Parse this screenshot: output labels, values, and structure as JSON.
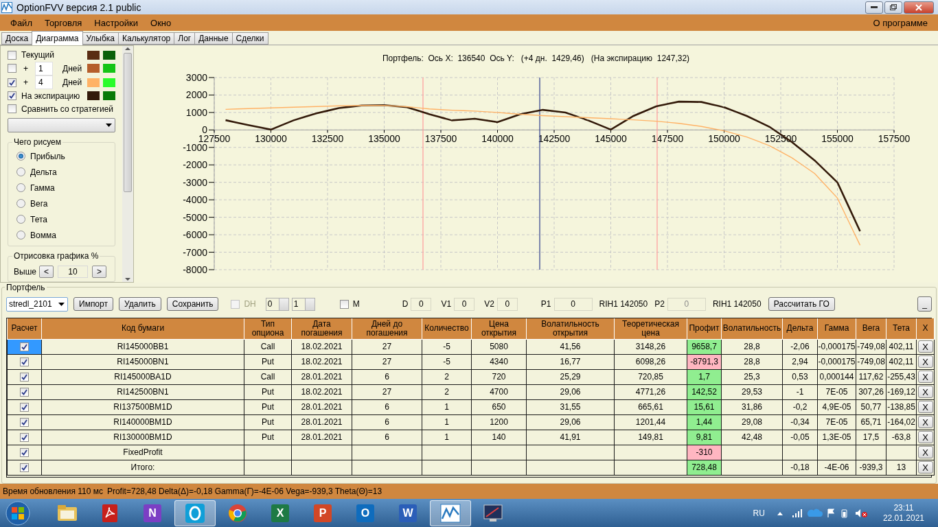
{
  "window": {
    "title": "OptionFVV версия 2.1 public"
  },
  "menu": [
    {
      "label": "Файл"
    },
    {
      "label": "Торговля"
    },
    {
      "label": "Настройки"
    },
    {
      "label": "Окно"
    }
  ],
  "menu_right": {
    "label": "О программе"
  },
  "tabs": [
    {
      "label": "Доска",
      "selected": false
    },
    {
      "label": "Диаграмма",
      "selected": true
    },
    {
      "label": "Улыбка",
      "selected": false
    },
    {
      "label": "Калькулятор",
      "selected": false
    },
    {
      "label": "Лог",
      "selected": false
    },
    {
      "label": "Данные",
      "selected": false
    },
    {
      "label": "Сделки",
      "selected": false
    }
  ],
  "left_panel": {
    "rows": [
      {
        "kind": "check",
        "label": "Текущий",
        "checked": false,
        "swatches": [
          {
            "color": "#5a2d14"
          },
          {
            "color": "#0a600a"
          }
        ]
      },
      {
        "kind": "days",
        "prefix": "+",
        "value": "1",
        "unit": "Дней",
        "checked": false,
        "swatches": [
          {
            "color": "#b55e2b"
          },
          {
            "color": "#15c415"
          }
        ]
      },
      {
        "kind": "days",
        "prefix": "+",
        "value": "4",
        "unit": "Дней",
        "checked": true,
        "swatches": [
          {
            "color": "#ffb266"
          },
          {
            "color": "#2afc2a"
          }
        ]
      },
      {
        "kind": "check",
        "label": "На экспирацию",
        "checked": true,
        "swatches": [
          {
            "color": "#331a0a"
          },
          {
            "color": "#087a08"
          }
        ]
      },
      {
        "kind": "check",
        "label": "Сравнить со стратегией",
        "checked": false
      }
    ],
    "draw_group": {
      "title": "Чего рисуем",
      "options": [
        {
          "label": "Прибыль",
          "selected": true
        },
        {
          "label": "Дельта",
          "selected": false
        },
        {
          "label": "Гамма",
          "selected": false
        },
        {
          "label": "Вега",
          "selected": false
        },
        {
          "label": "Тета",
          "selected": false
        },
        {
          "label": "Вомма",
          "selected": false
        }
      ]
    },
    "render_group": {
      "title": "Отрисовка графика %",
      "label": "Выше",
      "dec": "<",
      "value": "10",
      "inc": ">"
    }
  },
  "chart": {
    "title": "Портфель:  Ось X:  136540  Ось Y:   (+4 дн.  1429,46)   (На экспирацию  1247,32)",
    "chart_data": {
      "type": "line",
      "x": [
        128000,
        129000,
        130000,
        131000,
        132000,
        133000,
        134000,
        135000,
        136000,
        137000,
        138000,
        139000,
        140000,
        141000,
        142000,
        143000,
        144000,
        145000,
        146000,
        147000,
        148000,
        149000,
        150000,
        151000,
        152000,
        153000,
        154000,
        155000,
        156000
      ],
      "series": [
        {
          "color": "#331a0a",
          "values": [
            560,
            280,
            20,
            550,
            950,
            1250,
            1400,
            1420,
            1300,
            900,
            550,
            640,
            450,
            900,
            1150,
            1000,
            550,
            20,
            800,
            1350,
            1620,
            1600,
            1300,
            800,
            180,
            -700,
            -1750,
            -3000,
            -5800
          ]
        },
        {
          "color": "#ffb266",
          "values": [
            1180,
            1220,
            1260,
            1300,
            1340,
            1380,
            1400,
            1400,
            1330,
            1200,
            1130,
            1080,
            1000,
            900,
            820,
            760,
            700,
            640,
            580,
            500,
            380,
            200,
            -50,
            -400,
            -900,
            -1600,
            -2500,
            -3900,
            -6600
          ]
        }
      ],
      "xlim": [
        127500,
        157500
      ],
      "ylim": [
        -8000,
        3000
      ],
      "xticks": [
        127500,
        130000,
        132500,
        135000,
        137500,
        140000,
        142500,
        145000,
        147500,
        150000,
        152500,
        155000,
        157500
      ],
      "yticks": [
        -8000,
        -7000,
        -6000,
        -5000,
        -4000,
        -3000,
        -2000,
        -1000,
        0,
        1000,
        2000,
        3000
      ],
      "grid": true,
      "ref_lines": [
        {
          "axis": "x",
          "value": 136712,
          "color": "#ff9a9a"
        },
        {
          "axis": "x",
          "value": 141864,
          "color": "#2a3a8a"
        },
        {
          "axis": "x",
          "value": 147045,
          "color": "#ff9a9a"
        }
      ]
    }
  },
  "portfolio": {
    "title": "Портфель",
    "toolbar": {
      "portfolio": "stredl_2101",
      "buttons": [
        {
          "label": "Импорт"
        },
        {
          "label": "Удалить"
        },
        {
          "label": "Сохранить"
        }
      ],
      "dh": {
        "label": "DH",
        "checked": false,
        "disabled": true
      },
      "spinners": [
        {
          "value": "0"
        },
        {
          "value": "1"
        }
      ],
      "m": {
        "label": "M",
        "checked": false
      },
      "fields": [
        {
          "label": "D",
          "value": "0",
          "disabled": false
        },
        {
          "label": "V1",
          "value": "0",
          "disabled": false
        },
        {
          "label": "V2",
          "value": "0",
          "disabled": false
        },
        {
          "label": "P1",
          "value": "0",
          "disabled": false,
          "note": "RIH1 142050"
        },
        {
          "label": "P2",
          "value": "0",
          "disabled": true,
          "note": "RIH1 142050"
        }
      ],
      "calc_button": "Рассчитать ГО",
      "minimize_button": "_"
    },
    "table": {
      "columns": [
        "Расчет",
        "Код бумаги",
        "Тип\nопциона",
        "Дата\nпогашения",
        "Дней до\nпогашения",
        "Количество",
        "Цена\nоткрытия",
        "Волатильность\nоткрытия",
        "Теоретическая\nцена",
        "Профит",
        "Волатильность",
        "Дельта",
        "Гамма",
        "Вега",
        "Тета",
        "X"
      ],
      "rows": [
        {
          "checked": true,
          "selected": true,
          "color": "#90ee90",
          "cells": [
            "",
            "RI145000BB1",
            "Call",
            "18.02.2021",
            "27",
            "-5",
            "5080",
            "41,56",
            "3148,26",
            "9658,7",
            "28,8",
            "-2,06",
            "-0,000175",
            "-749,08",
            "402,11",
            "X"
          ]
        },
        {
          "checked": true,
          "selected": false,
          "color": "#ffb6c1",
          "cells": [
            "",
            "RI145000BN1",
            "Put",
            "18.02.2021",
            "27",
            "-5",
            "4340",
            "16,77",
            "6098,26",
            "-8791,3",
            "28,8",
            "2,94",
            "-0,000175",
            "-749,08",
            "402,11",
            "X"
          ]
        },
        {
          "checked": true,
          "selected": false,
          "color": "#90ee90",
          "cells": [
            "",
            "RI145000BA1D",
            "Call",
            "28.01.2021",
            "6",
            "2",
            "720",
            "25,29",
            "720,85",
            "1,7",
            "25,3",
            "0,53",
            "0,000144",
            "117,62",
            "-255,43",
            "X"
          ]
        },
        {
          "checked": true,
          "selected": false,
          "color": "#90ee90",
          "cells": [
            "",
            "RI142500BN1",
            "Put",
            "18.02.2021",
            "27",
            "2",
            "4700",
            "29,06",
            "4771,26",
            "142,52",
            "29,53",
            "-1",
            "7E-05",
            "307,26",
            "-169,12",
            "X"
          ]
        },
        {
          "checked": true,
          "selected": false,
          "color": "#90ee90",
          "cells": [
            "",
            "RI137500BM1D",
            "Put",
            "28.01.2021",
            "6",
            "1",
            "650",
            "31,55",
            "665,61",
            "15,61",
            "31,86",
            "-0,2",
            "4,9E-05",
            "50,77",
            "-138,85",
            "X"
          ]
        },
        {
          "checked": true,
          "selected": false,
          "color": "#90ee90",
          "cells": [
            "",
            "RI140000BM1D",
            "Put",
            "28.01.2021",
            "6",
            "1",
            "1200",
            "29,06",
            "1201,44",
            "1,44",
            "29,08",
            "-0,34",
            "7E-05",
            "65,71",
            "-164,02",
            "X"
          ]
        },
        {
          "checked": true,
          "selected": false,
          "color": "#90ee90",
          "cells": [
            "",
            "RI130000BM1D",
            "Put",
            "28.01.2021",
            "6",
            "1",
            "140",
            "41,91",
            "149,81",
            "9,81",
            "42,48",
            "-0,05",
            "1,3E-05",
            "17,5",
            "-63,8",
            "X"
          ]
        },
        {
          "checked": true,
          "selected": false,
          "color": "#ffb6c1",
          "cells": [
            "",
            "FixedProfit",
            "",
            "",
            "",
            "",
            "",
            "",
            "",
            "-310",
            "",
            "",
            "",
            "",
            "",
            "X"
          ]
        },
        {
          "checked": true,
          "selected": false,
          "color": "#90ee90",
          "cells": [
            "",
            "Итого:",
            "",
            "",
            "",
            "",
            "",
            "",
            "",
            "728,48",
            "",
            "-0,18",
            "-4E-06",
            "-939,3",
            "13",
            "X"
          ]
        }
      ]
    }
  },
  "status_bar": {
    "update": "Время обновления 110 мс",
    "summary": "Profit=728,48 Delta(Δ)=-0,18 Gamma(Г)=-4E-06 Vega=-939,3 Theta(Θ)=13"
  },
  "taskbar": {
    "apps": [
      {
        "kind": "folder",
        "selected": false
      },
      {
        "kind": "pdf",
        "selected": false
      },
      {
        "kind": "letter",
        "glyph": "N",
        "color": "#7b3fc4",
        "selected": false
      },
      {
        "kind": "ring",
        "selected": true
      },
      {
        "kind": "globe",
        "selected": false
      },
      {
        "kind": "letter",
        "glyph": "X",
        "color": "#1e7a45",
        "selected": false
      },
      {
        "kind": "letter",
        "glyph": "P",
        "color": "#d24726",
        "selected": false
      },
      {
        "kind": "letter",
        "glyph": "O",
        "color": "#0f6cbd",
        "selected": false
      },
      {
        "kind": "letter",
        "glyph": "W",
        "color": "#2b5eb8",
        "selected": false
      },
      {
        "kind": "chart",
        "selected": true
      },
      {
        "kind": "screen",
        "selected": false
      }
    ],
    "lang": "RU",
    "time": "23:11",
    "date": "22.01.2021"
  }
}
